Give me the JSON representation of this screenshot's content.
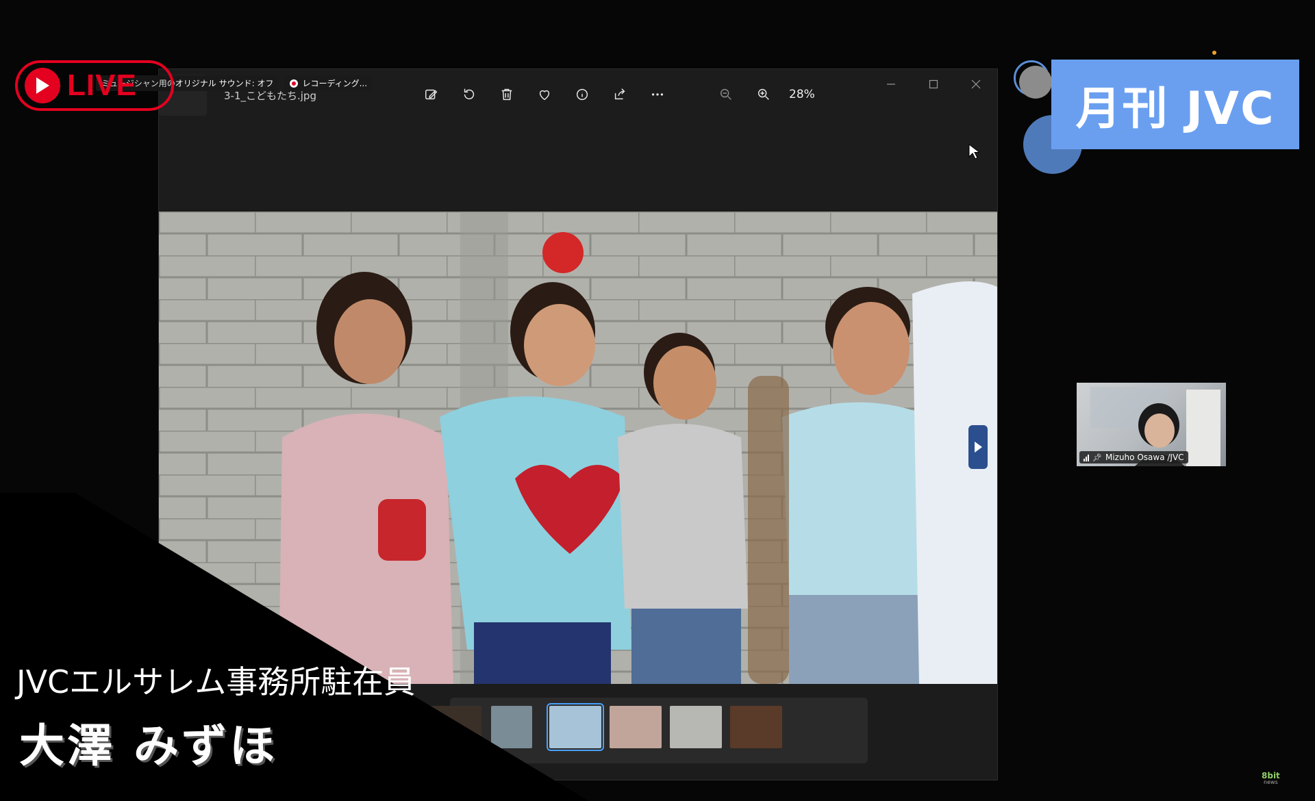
{
  "live_badge": {
    "label": "LIVE"
  },
  "recording_bar": {
    "original_sound": "ミュージシャン用のオリジナル サウンド: オフ",
    "recording": "レコーディング..."
  },
  "viewer": {
    "file_name": "3-1_こどもたち.jpg",
    "zoom_level": "28%",
    "tools": [
      "edit-image-icon",
      "rotate-icon",
      "delete-icon",
      "favorite-icon",
      "info-icon",
      "share-icon",
      "more-icon"
    ],
    "selected_thumbnail": 3,
    "thumbnail_colors": [
      "#3a3028",
      "#4a4844",
      "#7a8c96",
      "#a7c3d8",
      "#b7b7b3",
      "#5a3a28"
    ]
  },
  "banner": {
    "title": "月刊 JVC",
    "color": "#6a9ff0"
  },
  "participant": {
    "name": "Mizuho Osawa /JVC"
  },
  "caption": {
    "role": "JVCエルサレム事務所駐在員",
    "name": "大澤 みずほ"
  },
  "watermark": {
    "line1": "8bit",
    "line2": "news"
  },
  "colors": {
    "live_red": "#e4001f",
    "accent_blue": "#4aa3ff"
  }
}
